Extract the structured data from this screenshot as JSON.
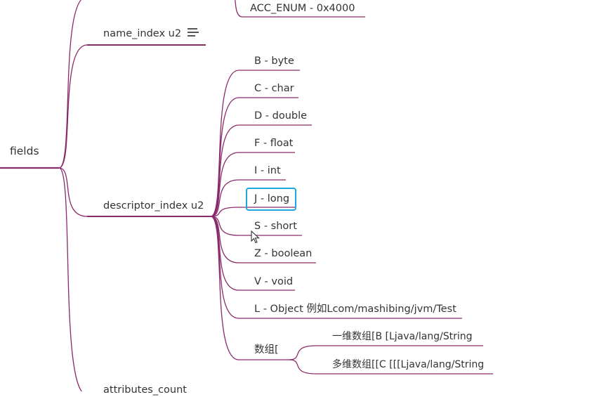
{
  "mindmap": {
    "accent_color": "#8b2a6b",
    "selection_color": "#1fa6dd",
    "root": {
      "label": "fields"
    },
    "top_node": {
      "label": "ACC_ENUM - 0x4000"
    },
    "name_index": {
      "label": "name_index u2",
      "note_icon": "notes-icon"
    },
    "descriptor_index": {
      "label": "descriptor_index u2",
      "children": [
        "B - byte",
        "C - char",
        "D - double",
        "F - float",
        "I - int",
        "J - long",
        "S - short",
        "Z - boolean",
        "V - void",
        "L - Object 例如Lcom/mashibing/jvm/Test"
      ],
      "selected": "J - long",
      "array": {
        "label": "数组[",
        "children": [
          "一维数组[B [Ljava/lang/String",
          "多维数组[[C [[[Ljava/lang/String"
        ]
      }
    },
    "attributes_count": {
      "label": "attributes_count"
    }
  }
}
